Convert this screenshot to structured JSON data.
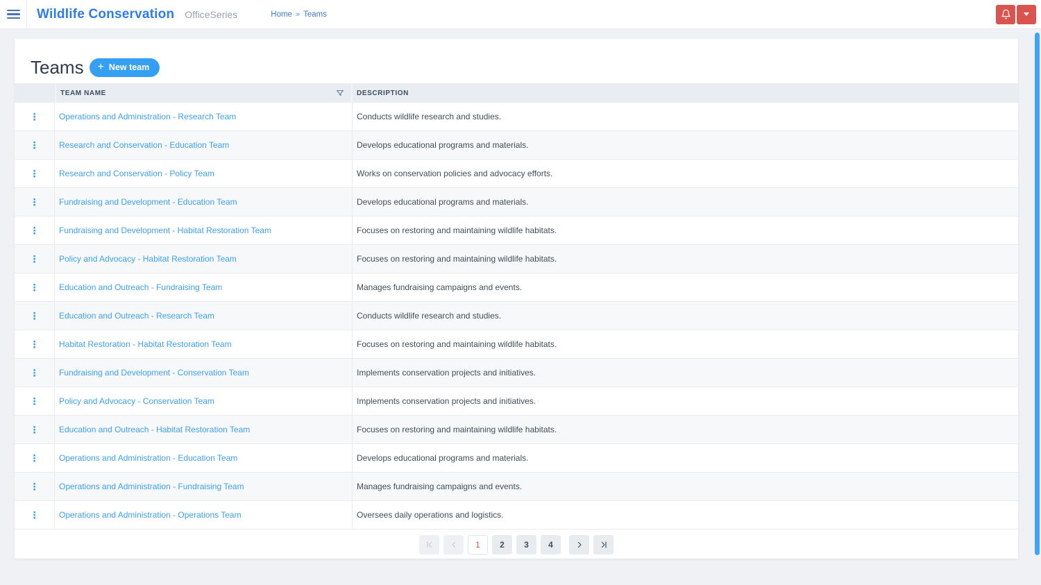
{
  "header": {
    "app_title": "Wildlife Conservation",
    "app_subtitle": "OfficeSeries",
    "breadcrumb": {
      "home": "Home",
      "separator": "»",
      "current": "Teams"
    }
  },
  "toolbar": {
    "page_title": "Teams",
    "new_team_label": "New team",
    "plus_glyph": "+"
  },
  "table": {
    "headers": {
      "team_name": "TEAM NAME",
      "description": "DESCRIPTION"
    },
    "kebab_glyph": "⋮",
    "rows": [
      {
        "name": "Operations and Administration - Research Team",
        "description": "Conducts wildlife research and studies."
      },
      {
        "name": "Research and Conservation - Education Team",
        "description": "Develops educational programs and materials."
      },
      {
        "name": "Research and Conservation - Policy Team",
        "description": "Works on conservation policies and advocacy efforts."
      },
      {
        "name": "Fundraising and Development - Education Team",
        "description": "Develops educational programs and materials."
      },
      {
        "name": "Fundraising and Development - Habitat Restoration Team",
        "description": "Focuses on restoring and maintaining wildlife habitats."
      },
      {
        "name": "Policy and Advocacy - Habitat Restoration Team",
        "description": "Focuses on restoring and maintaining wildlife habitats."
      },
      {
        "name": "Education and Outreach - Fundraising Team",
        "description": "Manages fundraising campaigns and events."
      },
      {
        "name": "Education and Outreach - Research Team",
        "description": "Conducts wildlife research and studies."
      },
      {
        "name": "Habitat Restoration - Habitat Restoration Team",
        "description": "Focuses on restoring and maintaining wildlife habitats."
      },
      {
        "name": "Fundraising and Development - Conservation Team",
        "description": "Implements conservation projects and initiatives."
      },
      {
        "name": "Policy and Advocacy - Conservation Team",
        "description": "Implements conservation projects and initiatives."
      },
      {
        "name": "Education and Outreach - Habitat Restoration Team",
        "description": "Focuses on restoring and maintaining wildlife habitats."
      },
      {
        "name": "Operations and Administration - Education Team",
        "description": "Develops educational programs and materials."
      },
      {
        "name": "Operations and Administration - Fundraising Team",
        "description": "Manages fundraising campaigns and events."
      },
      {
        "name": "Operations and Administration - Operations Team",
        "description": "Oversees daily operations and logistics."
      }
    ]
  },
  "pagination": {
    "current_page": "1",
    "pages": [
      "1",
      "2",
      "3",
      "4"
    ]
  },
  "colors": {
    "accent_blue": "#2c7cf0",
    "link_blue": "#3da1ef",
    "button_blue": "#35a0f3",
    "danger_red": "#d9534f",
    "active_page_red": "#e0524e",
    "scrollbar_blue": "#41a4f6",
    "table_header_bg": "#e9edf1"
  }
}
